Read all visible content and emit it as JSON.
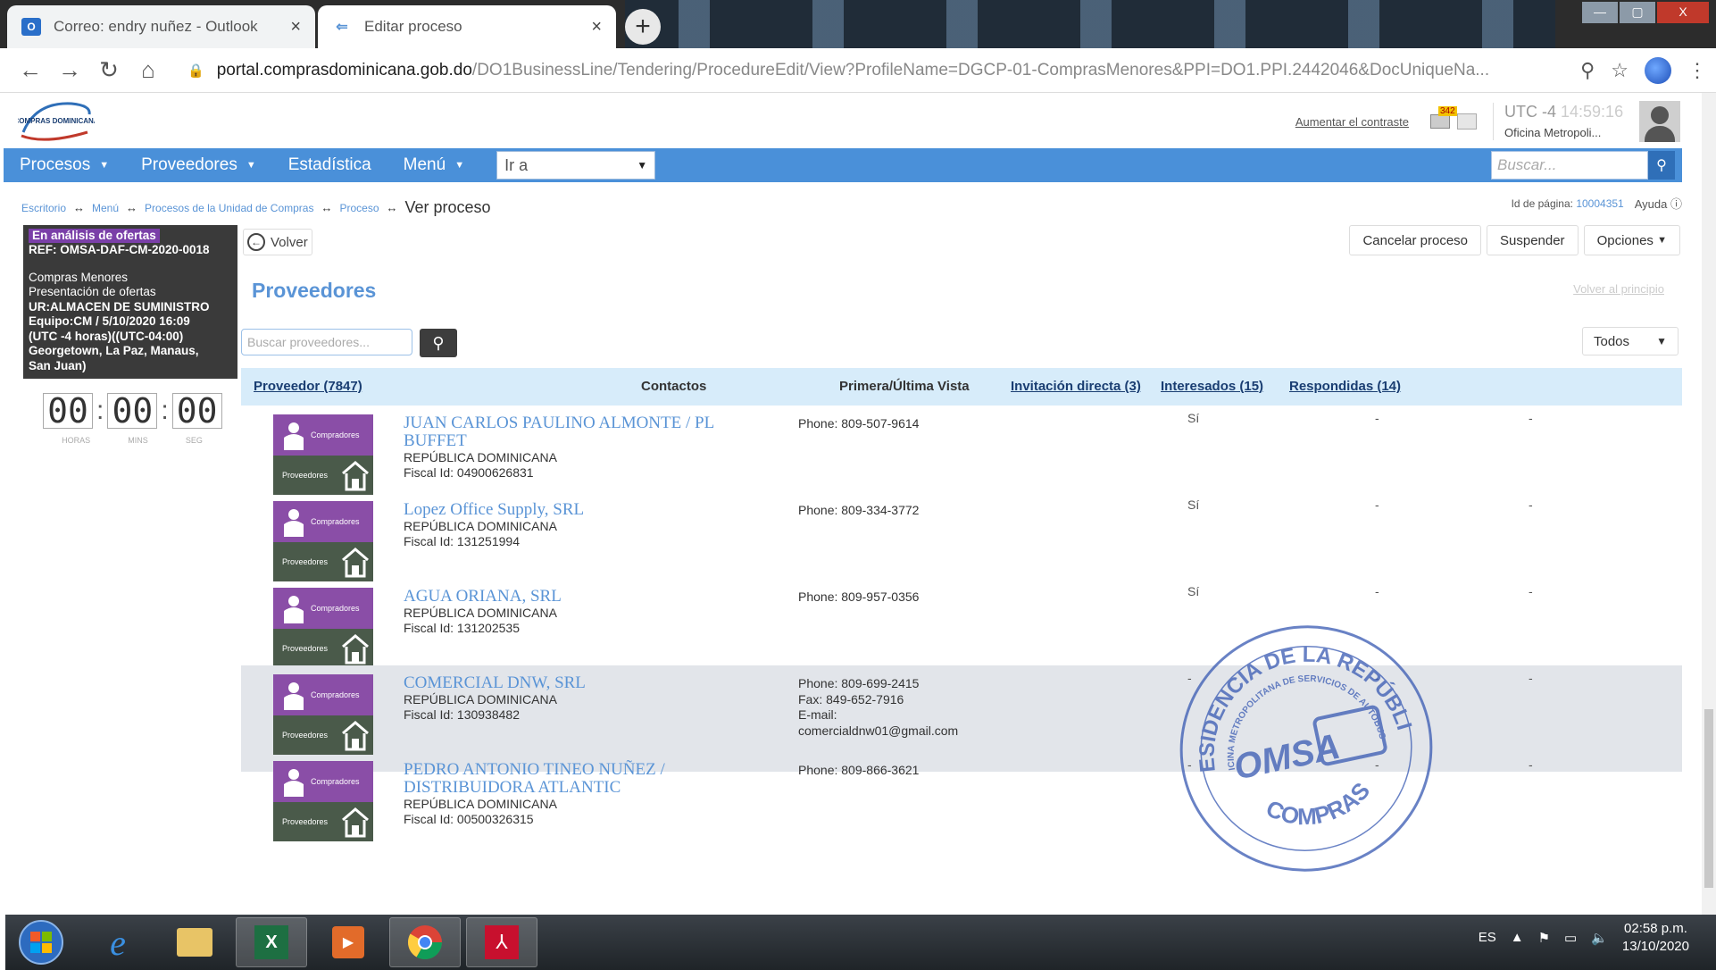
{
  "browser": {
    "tabs": [
      {
        "label": "Correo: endry nuñez - Outlook",
        "close": "×"
      },
      {
        "label": "Editar proceso",
        "close": "×"
      }
    ],
    "new_tab": "+",
    "url_host": "portal.comprasdominicana.gob.do",
    "url_path": "/DO1BusinessLine/Tendering/ProcedureEdit/View?ProfileName=DGCP-01-ComprasMenores&PPI=DO1.PPI.2442046&DocUniqueNa...",
    "window_buttons": {
      "minimize": "—",
      "maximize": "▢",
      "close": "X"
    }
  },
  "header": {
    "logo_text": "COMPRAS DOMINICANA",
    "contrast_link": "Aumentar el contraste",
    "badge_count": "342",
    "utc_label": "UTC -4",
    "utc_time": "14:59:16",
    "office": "Oficina Metropoli..."
  },
  "nav": {
    "items": [
      {
        "label": "Procesos",
        "has_caret": true
      },
      {
        "label": "Proveedores",
        "has_caret": true
      },
      {
        "label": "Estadística",
        "has_caret": false
      },
      {
        "label": "Menú",
        "has_caret": true
      }
    ],
    "goto_placeholder": "Ir a",
    "search_placeholder": "Buscar..."
  },
  "breadcrumb": {
    "items": [
      "Escritorio",
      "Menú",
      "Procesos de la Unidad de Compras",
      "Proceso"
    ],
    "current": "Ver proceso",
    "page_id_label": "Id de página:",
    "page_id": "10004351",
    "help": "Ayuda"
  },
  "status": {
    "state": "En análisis de ofertas",
    "ref": "REF: OMSA-DAF-CM-2020-0018",
    "type": "Compras Menores",
    "phase": "Presentación de ofertas",
    "ur": "UR:ALMACEN DE SUMINISTRO",
    "equipo": "Equipo:CM / 5/10/2020 16:09",
    "tz1": "(UTC -4 horas)((UTC-04:00)",
    "tz2": "Georgetown, La Paz, Manaus,",
    "tz3": "San Juan)"
  },
  "timer": {
    "hours": "00",
    "mins": "00",
    "secs": "00",
    "labels": [
      "HORAS",
      "MINS",
      "SEG"
    ]
  },
  "main": {
    "back_label": "Volver",
    "actions": [
      "Cancelar proceso",
      "Suspender",
      "Opciones"
    ],
    "section_title": "Proveedores",
    "to_top": "Volver al principio",
    "search_placeholder": "Buscar proveedores...",
    "filter_value": "Todos"
  },
  "table": {
    "headers": {
      "provider": "Proveedor (7847)",
      "contacts": "Contactos",
      "views": "Primera/Última Vista",
      "invitation": "Invitación directa (3)",
      "interested": "Interesados (15)",
      "responded": "Respondidas (14)"
    },
    "badge_top": "Compradores",
    "badge_bottom": "Proveedores",
    "rows": [
      {
        "name": "JUAN CARLOS PAULINO ALMONTE / PL BUFFET",
        "country": "REPÚBLICA DOMINICANA",
        "fiscal": "Fiscal Id: 04900626831",
        "contact": [
          "Phone: 809-507-9614"
        ],
        "invitation": "Sí",
        "interested": "-",
        "responded": "-"
      },
      {
        "name": "Lopez Office Supply, SRL",
        "country": "REPÚBLICA DOMINICANA",
        "fiscal": "Fiscal Id: 131251994",
        "contact": [
          "Phone: 809-334-3772"
        ],
        "invitation": "Sí",
        "interested": "-",
        "responded": "-"
      },
      {
        "name": "AGUA ORIANA, SRL",
        "country": "REPÚBLICA DOMINICANA",
        "fiscal": "Fiscal Id: 131202535",
        "contact": [
          "Phone: 809-957-0356"
        ],
        "invitation": "Sí",
        "interested": "-",
        "responded": "-"
      },
      {
        "name": "COMERCIAL DNW, SRL",
        "country": "REPÚBLICA DOMINICANA",
        "fiscal": "Fiscal Id: 130938482",
        "contact": [
          "Phone: 809-699-2415",
          "Fax: 849-652-7916",
          "E-mail:",
          "comercialdnw01@gmail.com"
        ],
        "invitation": "-",
        "interested": "-",
        "responded": "-"
      },
      {
        "name": "PEDRO ANTONIO TINEO NUÑEZ / DISTRIBUIDORA ATLANTIC",
        "country": "REPÚBLICA DOMINICANA",
        "fiscal": "Fiscal Id: 00500326315",
        "contact": [
          "Phone: 809-866-3621"
        ],
        "invitation": "-",
        "interested": "-",
        "responded": "-"
      }
    ]
  },
  "stamp": {
    "text_top": "PRESIDENCIA DE LA REPÚBLICA",
    "text_mid": "OFICINA METROPOLITANA DE SERVICIOS DE AUTOBUSES",
    "logo": "OMSA",
    "text_bottom": "COMPRAS"
  },
  "taskbar": {
    "lang": "ES",
    "time": "02:58 p.m.",
    "date": "13/10/2020"
  },
  "colors": {
    "nav_blue": "#4a90d9",
    "link_blue": "#5a94d6",
    "status_purple": "#7a3fa8",
    "stamp_blue": "#3f5fb5"
  }
}
